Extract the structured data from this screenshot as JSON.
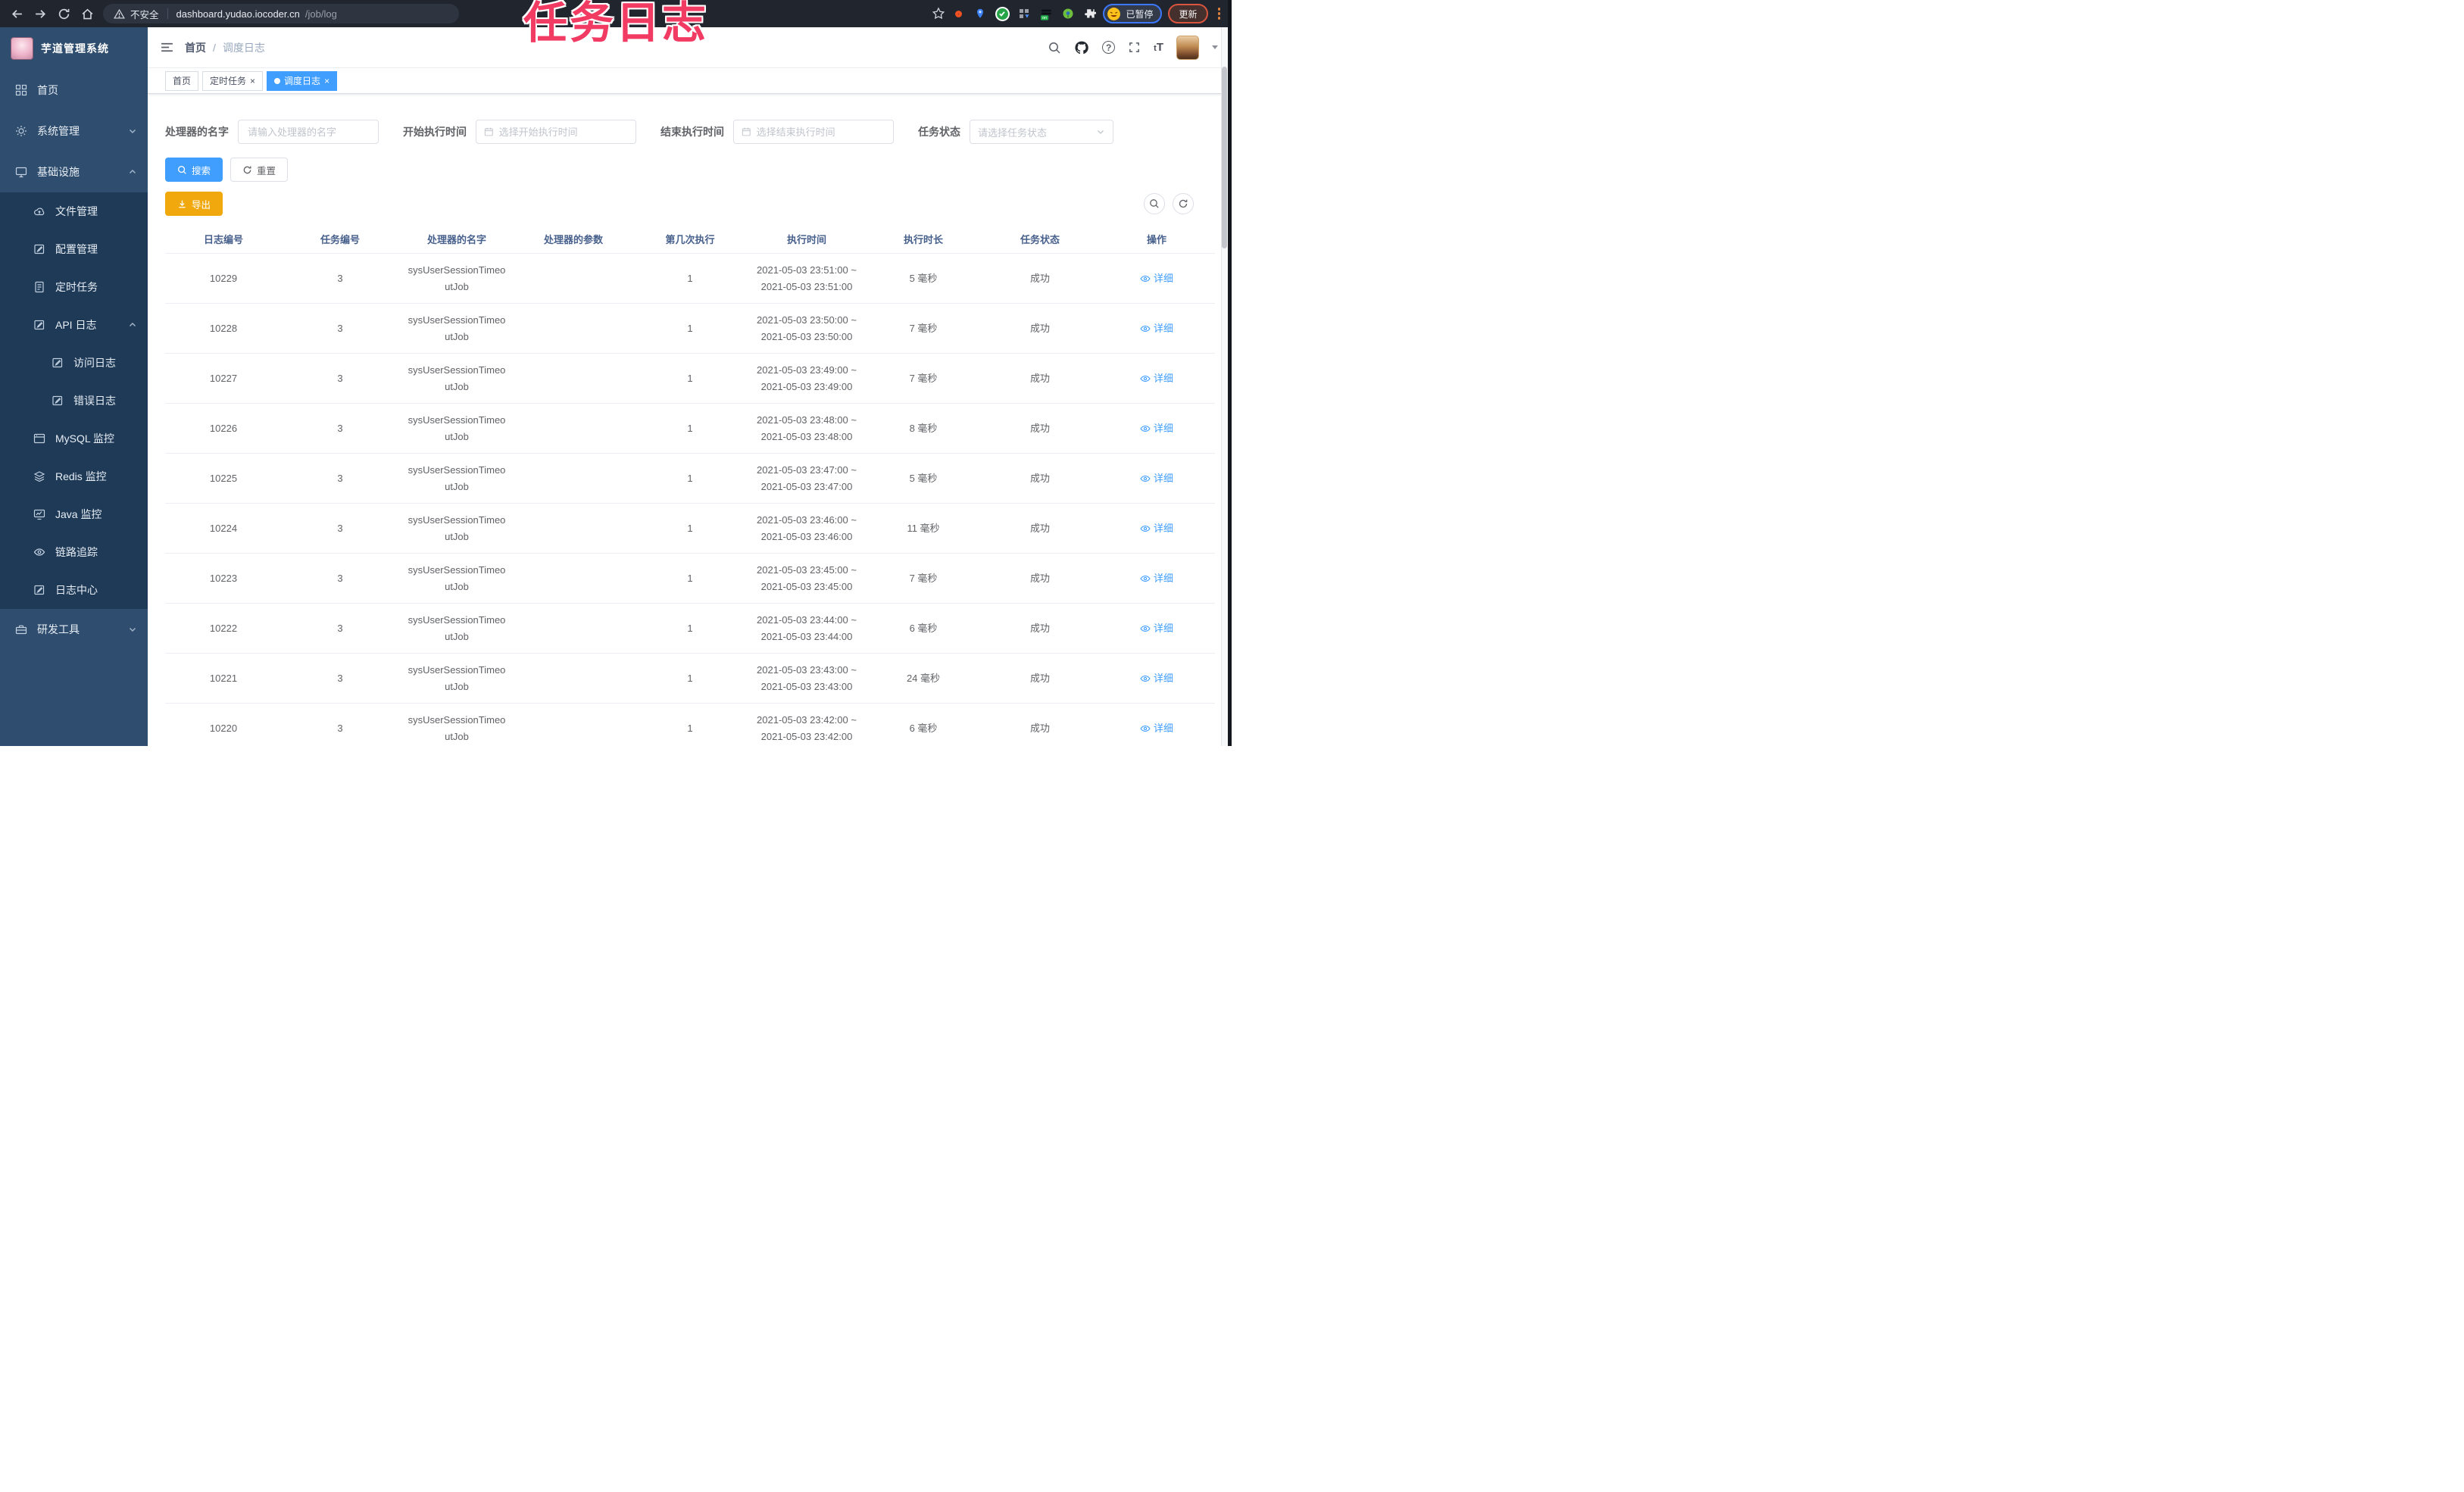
{
  "colors": {
    "primary": "#409eff",
    "warning": "#f0a80d",
    "sidebar_bg": "#2f4d6e",
    "submenu_bg": "#1e3a57",
    "browser_bar": "#20252e",
    "url_pill": "#2e3440",
    "annotation": "#f23b63",
    "table_header_text": "#48618c",
    "link": "#409eff"
  },
  "annotation": {
    "text": "任务日志"
  },
  "browser": {
    "security_label": "不安全",
    "url_host": "dashboard.yudao.iocoder.cn",
    "url_path": "/job/log",
    "profile_badge": "已暂停",
    "update_label": "更新"
  },
  "icons": {
    "search": "magnifier",
    "github": "octocat",
    "help": "question-circle",
    "fullscreen": "expand-arrows",
    "font_size": "tT",
    "export": "download-arrow",
    "refresh": "circular-arrow",
    "detail": "eye",
    "calendar": "calendar",
    "dropdown": "chevron-down"
  },
  "sidebar": {
    "title": "芋道管理系统",
    "items": [
      {
        "label": "首页"
      },
      {
        "label": "系统管理"
      },
      {
        "label": "基础设施"
      },
      {
        "label": "文件管理"
      },
      {
        "label": "配置管理"
      },
      {
        "label": "定时任务"
      },
      {
        "label": "API 日志"
      },
      {
        "label": "访问日志"
      },
      {
        "label": "错误日志"
      },
      {
        "label": "MySQL 监控"
      },
      {
        "label": "Redis 监控"
      },
      {
        "label": "Java 监控"
      },
      {
        "label": "链路追踪"
      },
      {
        "label": "日志中心"
      },
      {
        "label": "研发工具"
      }
    ]
  },
  "header": {
    "breadcrumb": [
      "首页",
      "调度日志"
    ],
    "separator": "/"
  },
  "tabs": [
    {
      "label": "首页",
      "closable": false,
      "active": false
    },
    {
      "label": "定时任务",
      "closable": true,
      "active": false
    },
    {
      "label": "调度日志",
      "closable": true,
      "active": true
    }
  ],
  "filters": {
    "handler_label": "处理器的名字",
    "handler_placeholder": "请输入处理器的名字",
    "start_label": "开始执行时间",
    "start_placeholder": "选择开始执行时间",
    "end_label": "结束执行时间",
    "end_placeholder": "选择结束执行时间",
    "status_label": "任务状态",
    "status_placeholder": "请选择任务状态",
    "search_label": "搜索",
    "reset_label": "重置",
    "export_label": "导出"
  },
  "table": {
    "headers": [
      "日志编号",
      "任务编号",
      "处理器的名字",
      "处理器的参数",
      "第几次执行",
      "执行时间",
      "执行时长",
      "任务状态",
      "操作"
    ],
    "rows": [
      {
        "log_id": "10229",
        "task_id": "3",
        "handler": "sysUserSessionTimeoutJob",
        "param": "",
        "exec_index": "1",
        "time_start": "2021-05-03 23:51:00 ~",
        "time_end": "2021-05-03 23:51:00",
        "duration": "5 毫秒",
        "status": "成功",
        "action": "详细"
      },
      {
        "log_id": "10228",
        "task_id": "3",
        "handler": "sysUserSessionTimeoutJob",
        "param": "",
        "exec_index": "1",
        "time_start": "2021-05-03 23:50:00 ~",
        "time_end": "2021-05-03 23:50:00",
        "duration": "7 毫秒",
        "status": "成功",
        "action": "详细"
      },
      {
        "log_id": "10227",
        "task_id": "3",
        "handler": "sysUserSessionTimeoutJob",
        "param": "",
        "exec_index": "1",
        "time_start": "2021-05-03 23:49:00 ~",
        "time_end": "2021-05-03 23:49:00",
        "duration": "7 毫秒",
        "status": "成功",
        "action": "详细"
      },
      {
        "log_id": "10226",
        "task_id": "3",
        "handler": "sysUserSessionTimeoutJob",
        "param": "",
        "exec_index": "1",
        "time_start": "2021-05-03 23:48:00 ~",
        "time_end": "2021-05-03 23:48:00",
        "duration": "8 毫秒",
        "status": "成功",
        "action": "详细"
      },
      {
        "log_id": "10225",
        "task_id": "3",
        "handler": "sysUserSessionTimeoutJob",
        "param": "",
        "exec_index": "1",
        "time_start": "2021-05-03 23:47:00 ~",
        "time_end": "2021-05-03 23:47:00",
        "duration": "5 毫秒",
        "status": "成功",
        "action": "详细"
      },
      {
        "log_id": "10224",
        "task_id": "3",
        "handler": "sysUserSessionTimeoutJob",
        "param": "",
        "exec_index": "1",
        "time_start": "2021-05-03 23:46:00 ~",
        "time_end": "2021-05-03 23:46:00",
        "duration": "11 毫秒",
        "status": "成功",
        "action": "详细"
      },
      {
        "log_id": "10223",
        "task_id": "3",
        "handler": "sysUserSessionTimeoutJob",
        "param": "",
        "exec_index": "1",
        "time_start": "2021-05-03 23:45:00 ~",
        "time_end": "2021-05-03 23:45:00",
        "duration": "7 毫秒",
        "status": "成功",
        "action": "详细"
      },
      {
        "log_id": "10222",
        "task_id": "3",
        "handler": "sysUserSessionTimeoutJob",
        "param": "",
        "exec_index": "1",
        "time_start": "2021-05-03 23:44:00 ~",
        "time_end": "2021-05-03 23:44:00",
        "duration": "6 毫秒",
        "status": "成功",
        "action": "详细"
      },
      {
        "log_id": "10221",
        "task_id": "3",
        "handler": "sysUserSessionTimeoutJob",
        "param": "",
        "exec_index": "1",
        "time_start": "2021-05-03 23:43:00 ~",
        "time_end": "2021-05-03 23:43:00",
        "duration": "24 毫秒",
        "status": "成功",
        "action": "详细"
      },
      {
        "log_id": "10220",
        "task_id": "3",
        "handler": "sysUserSessionTimeoutJob",
        "param": "",
        "exec_index": "1",
        "time_start": "2021-05-03 23:42:00 ~",
        "time_end": "2021-05-03 23:42:00",
        "duration": "6 毫秒",
        "status": "成功",
        "action": "详细"
      }
    ]
  }
}
